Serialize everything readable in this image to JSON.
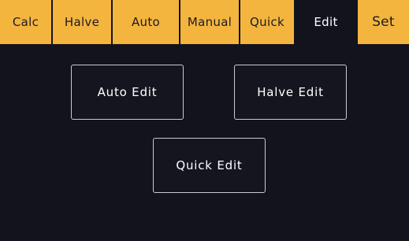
{
  "tabs": [
    {
      "label": "Calc",
      "active": false
    },
    {
      "label": "Halve",
      "active": false
    },
    {
      "label": "Auto",
      "active": false
    },
    {
      "label": "Manual",
      "active": false
    },
    {
      "label": "Quick",
      "active": false
    },
    {
      "label": "Edit",
      "active": true
    },
    {
      "label": "Set",
      "active": false
    }
  ],
  "edit_panel": {
    "auto_edit_label": "Auto Edit",
    "halve_edit_label": "Halve Edit",
    "quick_edit_label": "Quick Edit"
  },
  "colors": {
    "tab_background": "#f4b53f",
    "screen_background": "#12131c",
    "button_border": "#c8cad2"
  }
}
